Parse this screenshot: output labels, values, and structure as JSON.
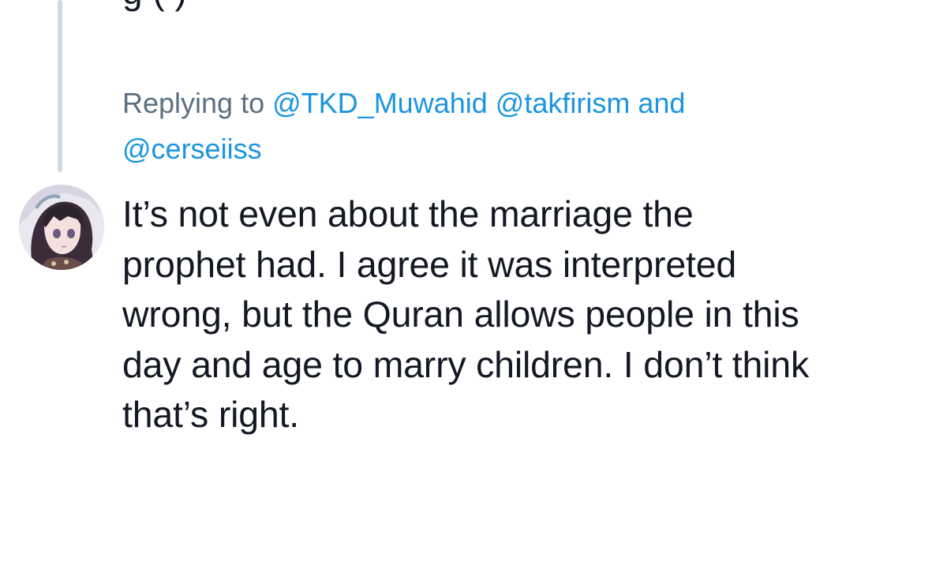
{
  "previous_tweet": {
    "cut_off_text": "g (  )"
  },
  "reply": {
    "prefix": "Replying to",
    "handles": [
      "@TKD_Muwahid",
      "@takfirism"
    ],
    "conjunction": "and",
    "last_handle": "@cerseiiss"
  },
  "tweet": {
    "lines": [
      "It’s not even about the marriage the",
      "prophet had. I agree it was interpreted",
      "wrong, but the Quran allows people in this",
      "day and age to marry children. I don’t think",
      "that’s right."
    ]
  },
  "colors": {
    "text": "#141823",
    "muted": "#5b7083",
    "link": "#1b95e0",
    "thread_line": "#cfd9de"
  },
  "icons": {
    "avatar": "anime-girl-avatar"
  }
}
